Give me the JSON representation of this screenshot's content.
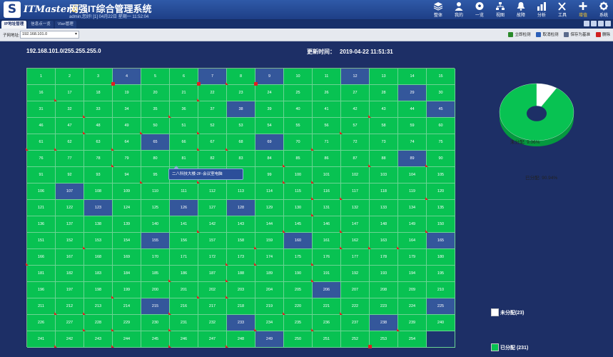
{
  "header": {
    "logo_letter": "S",
    "brand": "ITMaster",
    "brand_version": "6",
    "title": "网强IT综合管理系统",
    "user_info": "admin,您好! [1] 04月22日 星期一 11:52:04",
    "nav": [
      {
        "label": "整体",
        "icon": "layers-icon"
      },
      {
        "label": "我的",
        "icon": "user-icon"
      },
      {
        "label": "一览",
        "icon": "football-icon"
      },
      {
        "label": "视图",
        "icon": "network-icon"
      },
      {
        "label": "故障",
        "icon": "alarm-icon"
      },
      {
        "label": "分析",
        "icon": "chart-icon"
      },
      {
        "label": "工具",
        "icon": "tools-icon"
      },
      {
        "label": "增值",
        "icon": "plus-icon"
      },
      {
        "label": "系统",
        "icon": "gear-icon"
      }
    ],
    "active_nav": 7
  },
  "tabs": [
    {
      "label": "IP地址管理",
      "active": true
    },
    {
      "label": "信息点一览",
      "active": false
    },
    {
      "label": "Vlan管理",
      "active": false
    }
  ],
  "toolbar": {
    "subnet_label": "子网地址:",
    "subnet_value": "192.168.101.0",
    "actions": [
      {
        "label": "立即检测",
        "icon": "check-icon",
        "color": "#2a8a2a"
      },
      {
        "label": "取消检测",
        "icon": "cancel-icon",
        "color": "#2b5fb8"
      },
      {
        "label": "保存为基准",
        "icon": "save-icon",
        "color": "#5b6b8c"
      },
      {
        "label": "删除",
        "icon": "delete-icon",
        "color": "#d02020"
      }
    ]
  },
  "main": {
    "subnet_title": "192.168.101.0/255.255.255.0",
    "update_label": "更新时间：",
    "update_value": "2019-04-22 11:51:31",
    "tooltip": "二八科技大楼-2F-会议室电脑"
  },
  "grid": {
    "columns": 15,
    "cells": [
      1,
      2,
      3,
      4,
      5,
      6,
      7,
      8,
      9,
      10,
      11,
      12,
      13,
      14,
      15,
      16,
      17,
      18,
      19,
      20,
      21,
      22,
      23,
      24,
      25,
      26,
      27,
      28,
      29,
      30,
      31,
      32,
      33,
      34,
      35,
      36,
      37,
      38,
      39,
      40,
      41,
      42,
      43,
      44,
      45,
      46,
      47,
      48,
      49,
      50,
      51,
      52,
      53,
      54,
      55,
      56,
      57,
      58,
      59,
      60,
      61,
      62,
      63,
      64,
      65,
      66,
      67,
      68,
      69,
      70,
      71,
      72,
      73,
      74,
      75,
      76,
      77,
      78,
      79,
      80,
      81,
      82,
      83,
      84,
      85,
      86,
      87,
      88,
      89,
      90,
      91,
      92,
      93,
      94,
      95,
      96,
      97,
      98,
      99,
      100,
      101,
      102,
      103,
      104,
      105,
      106,
      107,
      108,
      109,
      110,
      111,
      112,
      113,
      114,
      115,
      116,
      117,
      118,
      119,
      120,
      121,
      122,
      123,
      124,
      125,
      126,
      127,
      128,
      129,
      130,
      131,
      132,
      133,
      134,
      135,
      136,
      137,
      138,
      139,
      140,
      141,
      142,
      143,
      144,
      145,
      146,
      147,
      148,
      149,
      150,
      151,
      152,
      153,
      154,
      155,
      156,
      157,
      158,
      159,
      160,
      161,
      162,
      163,
      164,
      165,
      166,
      167,
      168,
      169,
      170,
      171,
      172,
      173,
      174,
      175,
      176,
      177,
      178,
      179,
      180,
      181,
      182,
      183,
      184,
      185,
      186,
      187,
      188,
      189,
      190,
      191,
      192,
      193,
      194,
      195,
      196,
      197,
      198,
      199,
      200,
      201,
      202,
      203,
      204,
      205,
      206,
      207,
      208,
      209,
      210,
      211,
      212,
      213,
      214,
      215,
      216,
      217,
      218,
      219,
      220,
      221,
      222,
      223,
      224,
      225,
      226,
      227,
      228,
      229,
      230,
      231,
      232,
      233,
      234,
      235,
      236,
      237,
      238,
      239,
      240,
      241,
      242,
      243,
      244,
      245,
      246,
      247,
      248,
      249,
      250,
      251,
      252,
      253,
      254
    ],
    "unallocated": [
      4,
      7,
      9,
      12,
      29,
      38,
      45,
      65,
      69,
      89,
      107,
      123,
      126,
      128,
      155,
      160,
      165,
      206,
      215,
      225,
      233,
      238,
      249
    ],
    "red_markers": [
      8,
      17,
      22,
      33,
      36,
      43,
      48,
      50,
      52,
      57,
      61,
      62,
      64,
      67,
      68,
      71,
      79,
      85,
      88,
      90,
      95,
      97,
      100,
      101,
      116,
      117,
      120,
      131,
      142,
      145,
      147,
      150,
      153,
      159,
      162,
      163,
      164,
      166,
      173,
      174,
      176,
      186,
      188,
      191,
      199,
      202,
      203,
      212,
      213,
      216,
      220,
      222,
      228,
      229,
      231,
      234,
      236,
      239,
      242,
      244,
      246,
      248
    ],
    "selected": [
      4,
      7,
      9,
      253
    ]
  },
  "chart_data": {
    "type": "pie",
    "slices": [
      {
        "label": "未分配: 9.06%",
        "value": 9.06,
        "color": "#ffffff"
      },
      {
        "label": "已分配: 90.94%",
        "value": 90.94,
        "color": "#08c252"
      }
    ]
  },
  "legend": {
    "unallocated": "未分配(23)",
    "allocated": "已分配 (231)",
    "unallocated_color": "#ffffff",
    "allocated_color": "#08c252"
  },
  "colors": {
    "allocated": "#08c252",
    "unallocated": "#34579b",
    "marker": "#e02020",
    "background": "#1d2f66"
  }
}
